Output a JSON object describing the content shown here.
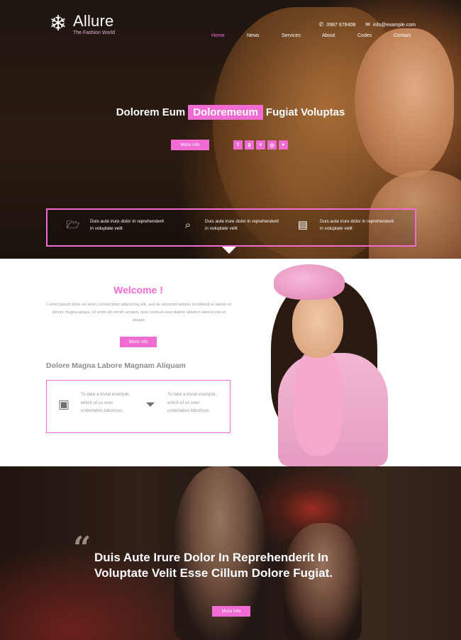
{
  "header": {
    "logo": {
      "name": "Allure",
      "tagline": "The Fashion World",
      "icon": "snowflake-icon"
    },
    "contact": {
      "phone": "0987 678408",
      "email": "info@example.com"
    },
    "nav": [
      {
        "label": "Home",
        "active": true
      },
      {
        "label": "News",
        "active": false
      },
      {
        "label": "Services",
        "active": false
      },
      {
        "label": "About",
        "active": false
      },
      {
        "label": "Codes",
        "active": false
      },
      {
        "label": "Contact",
        "active": false
      }
    ]
  },
  "hero": {
    "title_before": "Dolorem Eum",
    "title_highlight": "Doloremeum",
    "title_after": "Fugiat Voluptas",
    "button": "More info",
    "socials": [
      "twitter-icon",
      "google-plus-icon",
      "vimeo-icon",
      "dribbble-icon",
      "flickr-icon"
    ],
    "features": [
      {
        "icon": "folder-open-icon",
        "text": "Duis aute irure dolor in reprehenderit in voluptate velit"
      },
      {
        "icon": "search-icon",
        "text": "Duis aute irure dolor in reprehenderit in voluptate velit"
      },
      {
        "icon": "desktop-icon",
        "text": "Duis aute irure dolor in reprehenderit in voluptate velit"
      }
    ]
  },
  "welcome": {
    "title": "Welcome !",
    "text": "Lorem ipsum dolor sit amet, consectetur adipiscing elit, sed do eiusmod tempor incididunt ut labore et dolore magna aliqua. Ut enim ad minim veniam, quis nostrud exercitation ullamco laboris nisi ut aliquip.",
    "button": "More info",
    "subtitle": "Dolore Magna Labore Magnam Aliquam",
    "items": [
      {
        "icon": "picture-icon",
        "text": "To take a trivial example, which of us ever undertakes laborious."
      },
      {
        "icon": "filter-icon",
        "text": "To take a trivial example, which of us ever undertakes laborious."
      }
    ]
  },
  "quote": {
    "mark": "“",
    "text": "Duis Aute Irure Dolor In Reprehenderit In Voluptate Velit Esse Cillum Dolore Fugiat.",
    "button": "More info"
  },
  "colors": {
    "accent": "#f06cd2",
    "dark": "#1e1510",
    "grey": "#8d8d8d"
  }
}
